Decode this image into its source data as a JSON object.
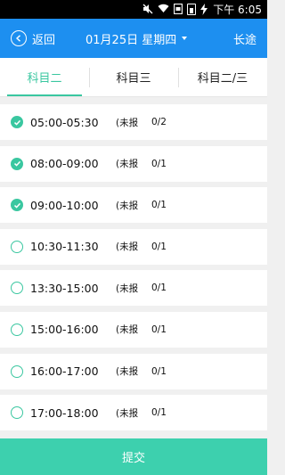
{
  "status_bar": {
    "time": "下午 6:05"
  },
  "header": {
    "back_label": "返回",
    "date_label": "01月25日 星期四",
    "right_label": "长途",
    "bg_color": "#1d8ff0"
  },
  "tabs": [
    {
      "label": "科目二",
      "active": true
    },
    {
      "label": "科目三",
      "active": false
    },
    {
      "label": "科目二/三",
      "active": false
    }
  ],
  "slots": [
    {
      "time": "05:00-05:30",
      "status": "(未报",
      "count": "0/2",
      "checked": true
    },
    {
      "time": "08:00-09:00",
      "status": "(未报",
      "count": "0/1",
      "checked": true
    },
    {
      "time": "09:00-10:00",
      "status": "(未报",
      "count": "0/1",
      "checked": true
    },
    {
      "time": "10:30-11:30",
      "status": "(未报",
      "count": "0/1",
      "checked": false
    },
    {
      "time": "13:30-15:00",
      "status": "(未报",
      "count": "0/1",
      "checked": false
    },
    {
      "time": "15:00-16:00",
      "status": "(未报",
      "count": "0/1",
      "checked": false
    },
    {
      "time": "16:00-17:00",
      "status": "(未报",
      "count": "0/1",
      "checked": false
    },
    {
      "time": "17:00-18:00",
      "status": "(未报",
      "count": "0/1",
      "checked": false
    }
  ],
  "submit_label": "提交",
  "accent_color": "#3ac7a0"
}
